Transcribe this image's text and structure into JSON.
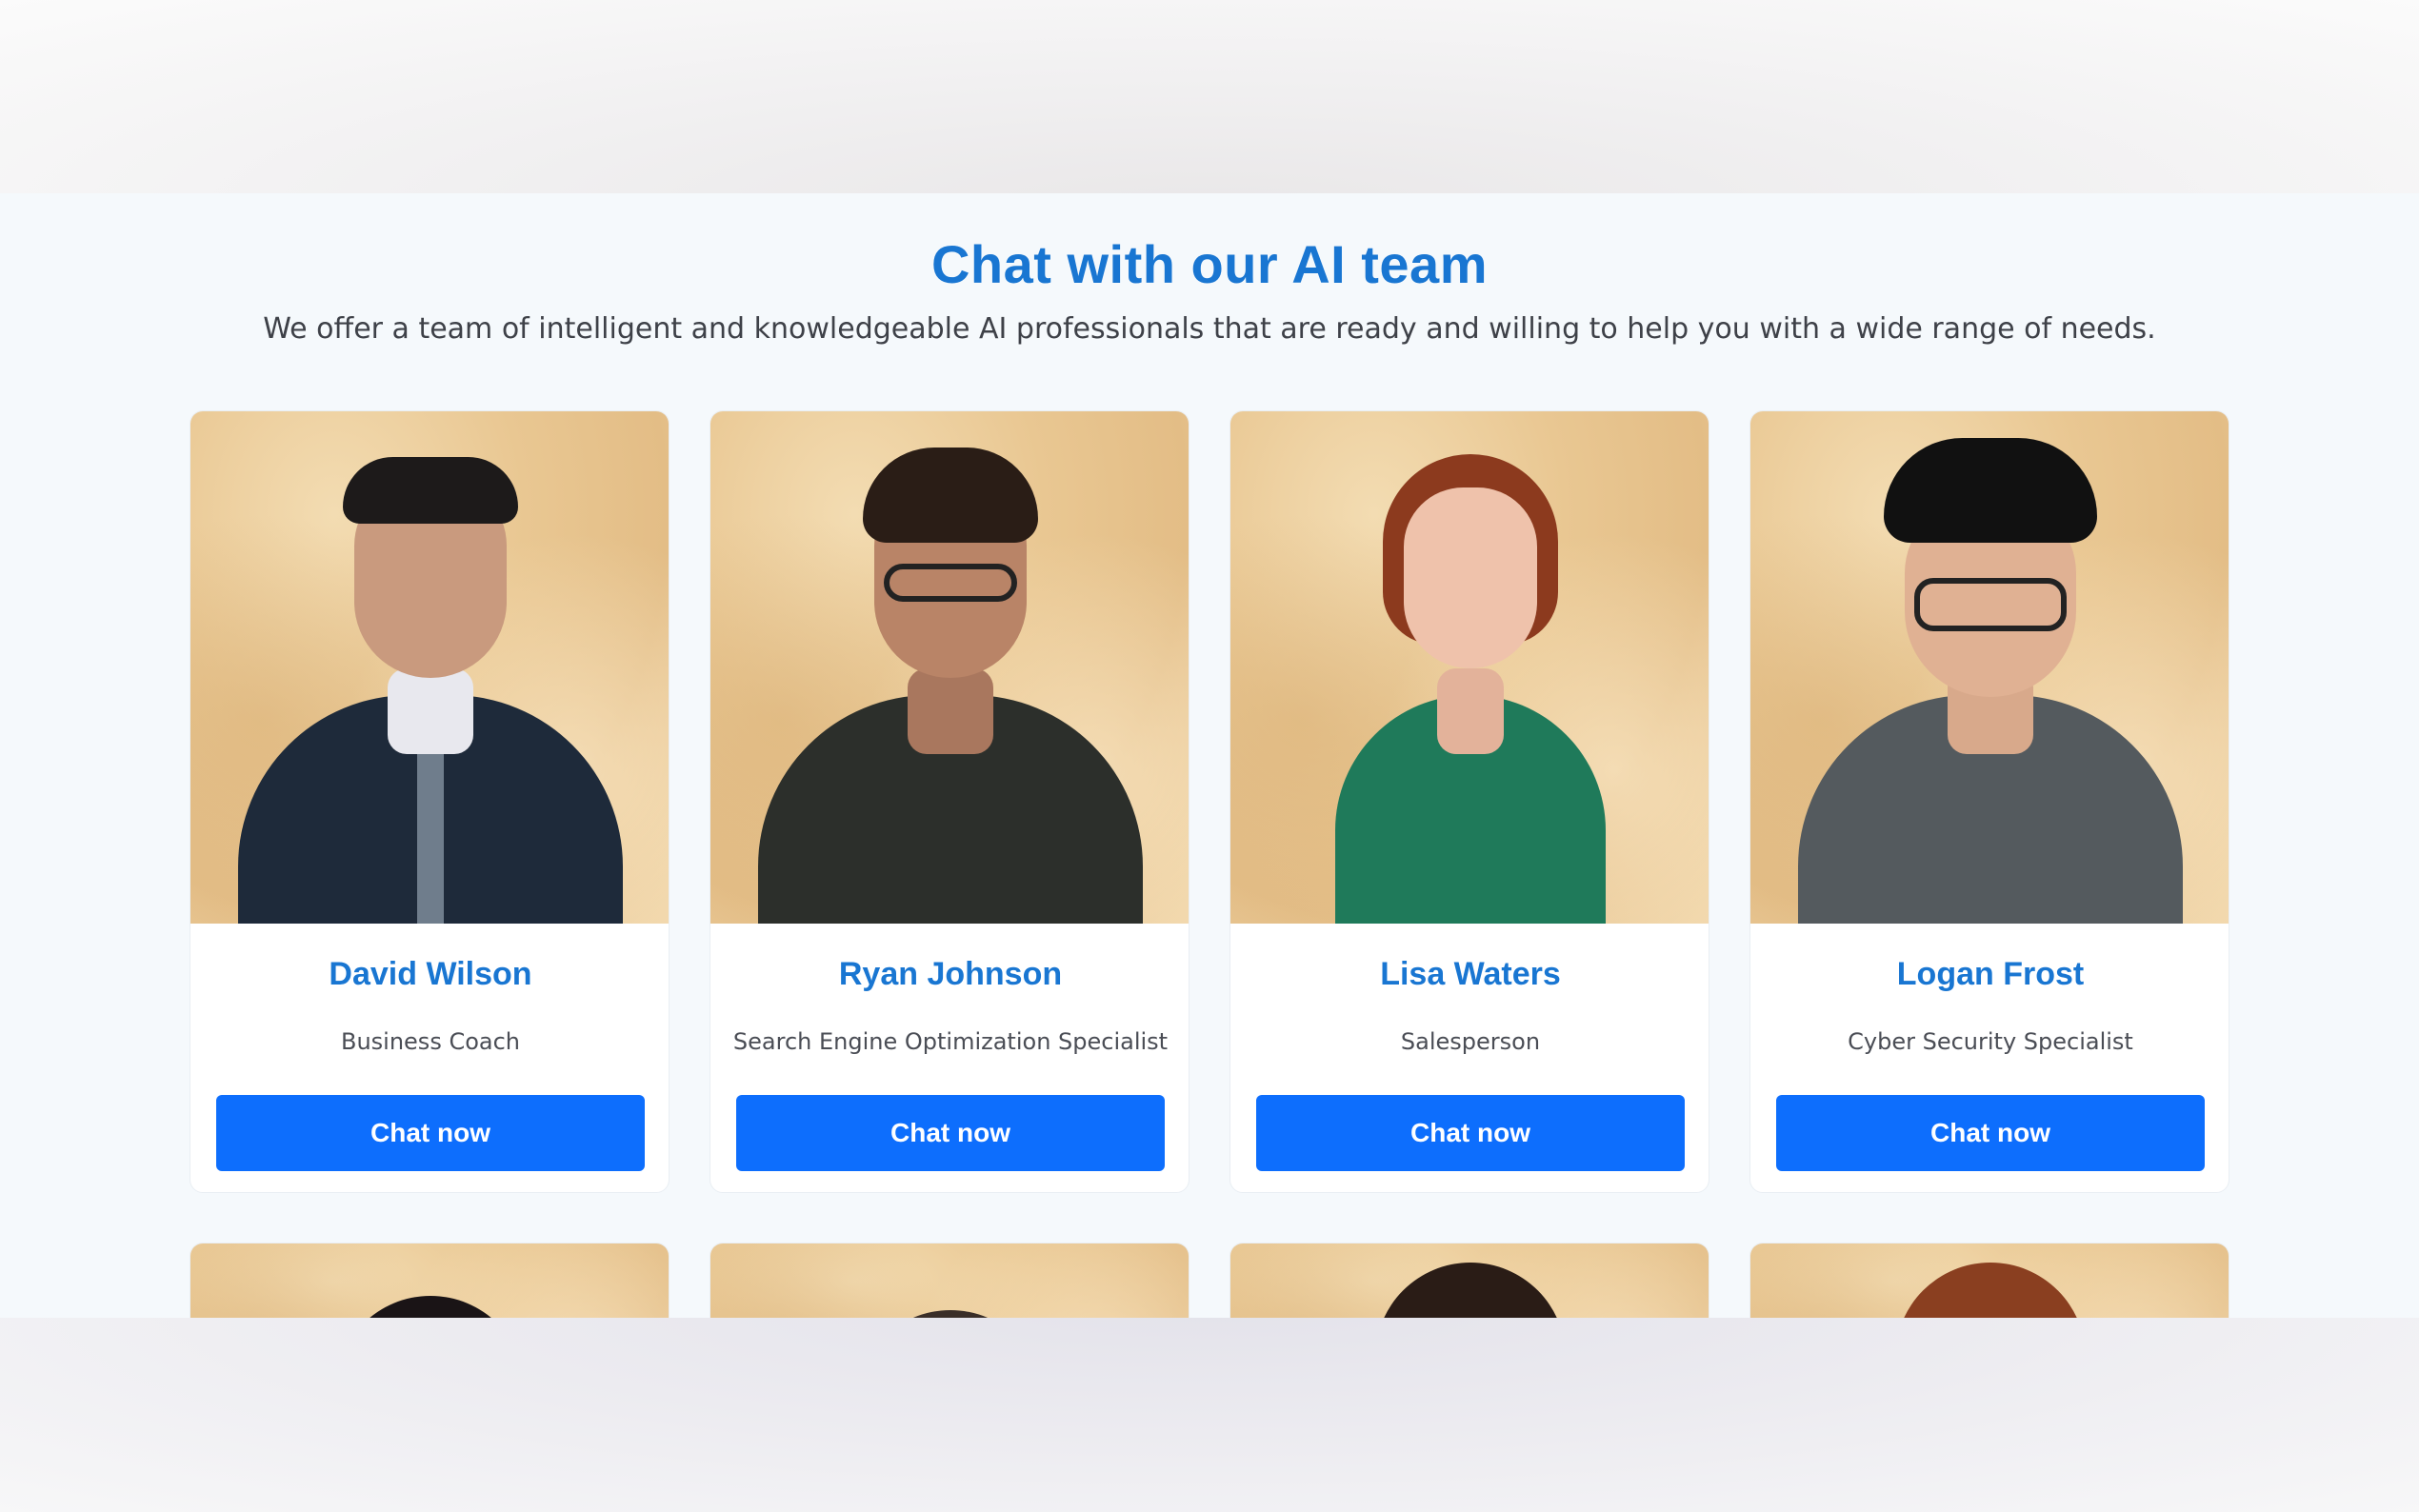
{
  "section": {
    "title": "Chat with our AI team",
    "subtitle": "We offer a team of intelligent and knowledgeable AI professionals that are ready and willing to help you with a wide range of needs."
  },
  "team": [
    {
      "name": "David Wilson",
      "role": "Business Coach",
      "button": "Chat now"
    },
    {
      "name": "Ryan Johnson",
      "role": "Search Engine Optimization Specialist",
      "button": "Chat now"
    },
    {
      "name": "Lisa Waters",
      "role": "Salesperson",
      "button": "Chat now"
    },
    {
      "name": "Logan Frost",
      "role": "Cyber Security Specialist",
      "button": "Chat now"
    }
  ],
  "colors": {
    "accent": "#1976d2",
    "button": "#0d6efd",
    "background": "#f5f9fc"
  }
}
